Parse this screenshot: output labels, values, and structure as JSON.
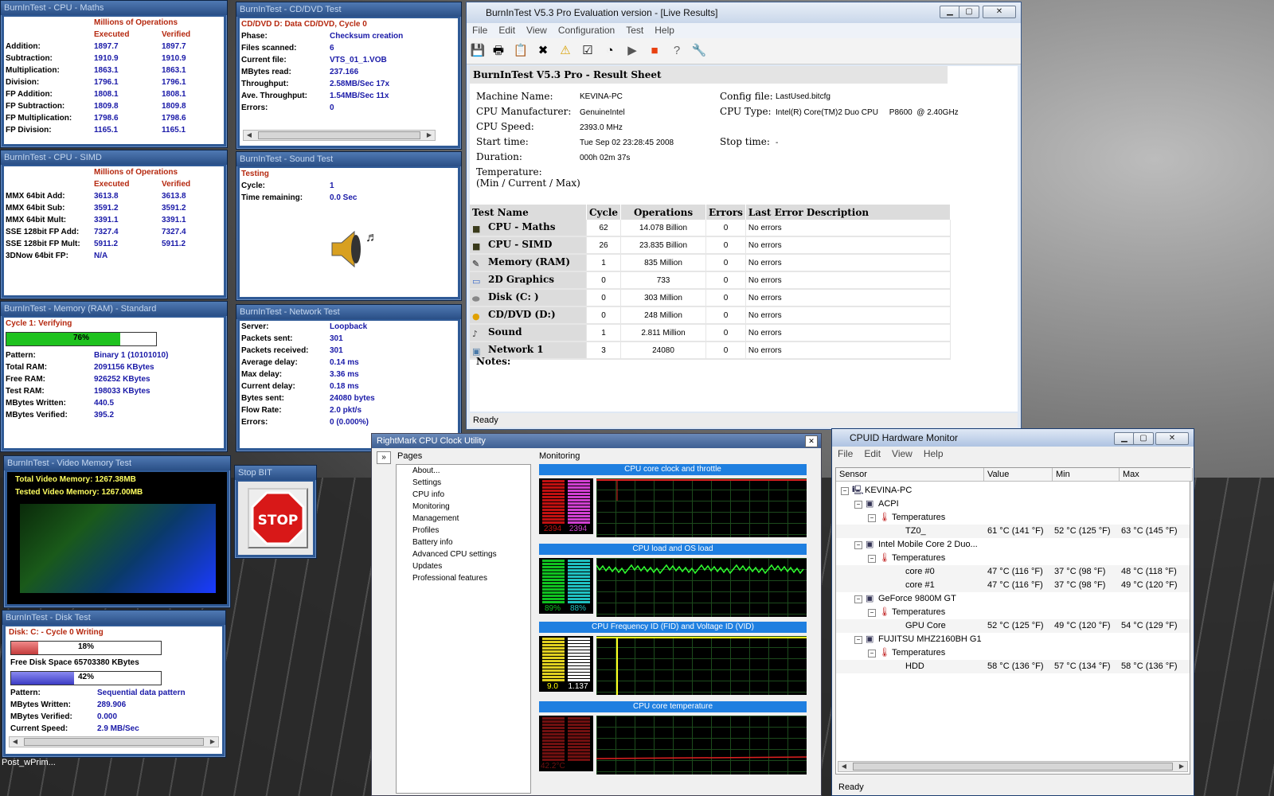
{
  "maths": {
    "title": "BurnInTest - CPU - Maths",
    "header1": "Millions of Operations",
    "col1": "Executed",
    "col2": "Verified",
    "rows": [
      [
        "Addition:",
        "1897.7",
        "1897.7"
      ],
      [
        "Subtraction:",
        "1910.9",
        "1910.9"
      ],
      [
        "Multiplication:",
        "1863.1",
        "1863.1"
      ],
      [
        "Division:",
        "1796.1",
        "1796.1"
      ],
      [
        "FP Addition:",
        "1808.1",
        "1808.1"
      ],
      [
        "FP Subtraction:",
        "1809.8",
        "1809.8"
      ],
      [
        "FP Multiplication:",
        "1798.6",
        "1798.6"
      ],
      [
        "FP Division:",
        "1165.1",
        "1165.1"
      ]
    ]
  },
  "simd": {
    "title": "BurnInTest - CPU - SIMD",
    "header1": "Millions of Operations",
    "col1": "Executed",
    "col2": "Verified",
    "rows": [
      [
        "MMX 64bit Add:",
        "3613.8",
        "3613.8"
      ],
      [
        "MMX 64bit Sub:",
        "3591.2",
        "3591.2"
      ],
      [
        "MMX 64bit Mult:",
        "3391.1",
        "3391.1"
      ],
      [
        "SSE 128bit FP Add:",
        "7327.4",
        "7327.4"
      ],
      [
        "SSE 128bit FP Mult:",
        "5911.2",
        "5911.2"
      ],
      [
        "3DNow 64bit FP:",
        "N/A",
        ""
      ]
    ]
  },
  "memory": {
    "title": "BurnInTest - Memory (RAM) - Standard",
    "status": "Cycle 1: Verifying",
    "progress": 76,
    "progress_label": "76%",
    "rows": [
      [
        "Pattern:",
        "Binary 1 (10101010)"
      ],
      [
        "Total RAM:",
        "2091156 KBytes"
      ],
      [
        "Free RAM:",
        "926252 KBytes"
      ],
      [
        "Test RAM:",
        "198033 KBytes"
      ],
      [
        "MBytes Written:",
        "440.5"
      ],
      [
        "MBytes Verified:",
        "395.2"
      ]
    ]
  },
  "video": {
    "title": "BurnInTest - Video Memory Test",
    "total": "Total Video Memory: 1267.38MB",
    "tested": "Tested Video Memory: 1267.00MB"
  },
  "disk": {
    "title": "BurnInTest - Disk Test",
    "status": "Disk: C: - Cycle 0 Writing",
    "progress1": 18,
    "progress1_label": "18%",
    "free": "Free Disk Space 65703380 KBytes",
    "progress2": 42,
    "progress2_label": "42%",
    "rows": [
      [
        "Pattern:",
        "Sequential data pattern"
      ],
      [
        "MBytes Written:",
        "289.906"
      ],
      [
        "MBytes Verified:",
        "0.000"
      ],
      [
        "Current Speed:",
        "2.9 MB/Sec"
      ]
    ]
  },
  "cd": {
    "title": "BurnInTest - CD/DVD Test",
    "status": "CD/DVD D: Data CD/DVD, Cycle 0",
    "rows": [
      [
        "Phase:",
        "Checksum creation"
      ],
      [
        "Files scanned:",
        "6"
      ],
      [
        "Current file:",
        "VTS_01_1.VOB"
      ],
      [
        "MBytes read:",
        "237.166"
      ],
      [
        "Throughput:",
        "2.58MB/Sec 17x"
      ],
      [
        "Ave. Throughput:",
        "1.54MB/Sec 11x"
      ],
      [
        "Errors:",
        "0"
      ]
    ]
  },
  "sound": {
    "title": "BurnInTest - Sound Test",
    "status": "Testing",
    "rows": [
      [
        "Cycle:",
        "1"
      ],
      [
        "Time remaining:",
        "0.0 Sec"
      ]
    ]
  },
  "network": {
    "title": "BurnInTest - Network Test",
    "rows": [
      [
        "Server:",
        "Loopback"
      ],
      [
        "Packets sent:",
        "301"
      ],
      [
        "Packets received:",
        "301"
      ],
      [
        "Average delay:",
        "0.14 ms"
      ],
      [
        "Max delay:",
        "3.36 ms"
      ],
      [
        "Current delay:",
        "0.18 ms"
      ],
      [
        "Bytes sent:",
        "24080 bytes"
      ],
      [
        "Flow Rate:",
        "2.0 pkt/s"
      ],
      [
        "Errors:",
        "0 (0.000%)"
      ]
    ]
  },
  "stop": {
    "title": "Stop BIT",
    "label": "STOP"
  },
  "main": {
    "title": "BurnInTest V5.3 Pro Evaluation version - [Live Results]",
    "menu": [
      "File",
      "Edit",
      "View",
      "Configuration",
      "Test",
      "Help"
    ],
    "sheet_title": "BurnInTest V5.3 Pro - Result Sheet",
    "machine_label": "Machine Name:",
    "machine": "KEVINA-PC",
    "manuf_label": "CPU Manufacturer:",
    "manuf": "GenuineIntel",
    "speed_label": "CPU Speed:",
    "speed": "2393.0 MHz",
    "start_label": "Start time:",
    "start": "Tue Sep 02 23:28:45 2008",
    "duration_label": "Duration:",
    "duration": "000h 02m 37s",
    "temp_label": "Temperature:",
    "temp_sub": "(Min / Current / Max)",
    "config_label": "Config file:",
    "config": "LastUsed.bitcfg",
    "cputype_label": "CPU Type:",
    "cputype": "Intel(R) Core(TM)2 Duo CPU     P8600  @ 2.40GHz",
    "stop_label": "Stop time:",
    "stop": "-",
    "columns": [
      "Test Name",
      "Cycle",
      "Operations",
      "Errors",
      "Last Error Description"
    ],
    "rows": [
      [
        "CPU - Maths",
        "62",
        "14.078 Billion",
        "0",
        "No errors"
      ],
      [
        "CPU - SIMD",
        "26",
        "23.835 Billion",
        "0",
        "No errors"
      ],
      [
        "Memory (RAM)",
        "1",
        "835 Million",
        "0",
        "No errors"
      ],
      [
        "2D Graphics",
        "0",
        "733",
        "0",
        "No errors"
      ],
      [
        "Disk (C: )",
        "0",
        "303 Million",
        "0",
        "No errors"
      ],
      [
        "CD/DVD (D:)",
        "0",
        "248 Million",
        "0",
        "No errors"
      ],
      [
        "Sound",
        "1",
        "2.811 Million",
        "0",
        "No errors"
      ],
      [
        "Network 1",
        "3",
        "24080",
        "0",
        "No errors"
      ]
    ],
    "notes": "Notes:",
    "status": "Ready"
  },
  "rightmark": {
    "title": "RightMark CPU Clock Utility",
    "pages_label": "Pages",
    "monitoring_label": "Monitoring",
    "pages": [
      "About...",
      "Settings",
      "CPU info",
      "Monitoring",
      "Management",
      "Profiles",
      "Battery info",
      "Advanced CPU settings",
      "Updates",
      "Professional features"
    ],
    "graphs": [
      {
        "title": "CPU core clock and throttle",
        "v1": "2394",
        "v2": "2394"
      },
      {
        "title": "CPU load and OS load",
        "v1": "89%",
        "v2": "88%"
      },
      {
        "title": "CPU Frequency ID (FID) and Voltage ID (VID)",
        "v1": "9.0",
        "v2": "1.137"
      },
      {
        "title": "CPU core temperature",
        "v1": "42.2°C",
        "v2": ""
      }
    ]
  },
  "hwmon": {
    "title": "CPUID Hardware Monitor",
    "menu": [
      "File",
      "Edit",
      "View",
      "Help"
    ],
    "columns": [
      "Sensor",
      "Value",
      "Min",
      "Max"
    ],
    "rows": [
      {
        "indent": 0,
        "name": "KEVINA-PC",
        "value": "",
        "min": "",
        "max": ""
      },
      {
        "indent": 1,
        "name": "ACPI",
        "value": "",
        "min": "",
        "max": ""
      },
      {
        "indent": 2,
        "name": "Temperatures",
        "value": "",
        "min": "",
        "max": ""
      },
      {
        "indent": 3,
        "name": "TZ0_",
        "value": "61 °C  (141 °F)",
        "min": "52 °C  (125 °F)",
        "max": "63 °C  (145 °F)"
      },
      {
        "indent": 1,
        "name": "Intel Mobile Core 2 Duo...",
        "value": "",
        "min": "",
        "max": ""
      },
      {
        "indent": 2,
        "name": "Temperatures",
        "value": "",
        "min": "",
        "max": ""
      },
      {
        "indent": 3,
        "name": "core #0",
        "value": "47 °C  (116 °F)",
        "min": "37 °C  (98 °F)",
        "max": "48 °C  (118 °F)"
      },
      {
        "indent": 3,
        "name": "core #1",
        "value": "47 °C  (116 °F)",
        "min": "37 °C  (98 °F)",
        "max": "49 °C  (120 °F)"
      },
      {
        "indent": 1,
        "name": "GeForce 9800M GT",
        "value": "",
        "min": "",
        "max": ""
      },
      {
        "indent": 2,
        "name": "Temperatures",
        "value": "",
        "min": "",
        "max": ""
      },
      {
        "indent": 3,
        "name": "GPU Core",
        "value": "52 °C  (125 °F)",
        "min": "49 °C  (120 °F)",
        "max": "54 °C  (129 °F)"
      },
      {
        "indent": 1,
        "name": "FUJITSU MHZ2160BH G1",
        "value": "",
        "min": "",
        "max": ""
      },
      {
        "indent": 2,
        "name": "Temperatures",
        "value": "",
        "min": "",
        "max": ""
      },
      {
        "indent": 3,
        "name": "HDD",
        "value": "58 °C  (136 °F)",
        "min": "57 °C  (134 °F)",
        "max": "58 °C  (136 °F)"
      }
    ],
    "status": "Ready"
  },
  "taskbar": {
    "label": "Post_wPrim..."
  },
  "colors": {
    "accent": "#1f7fe0",
    "value_blue": "#1a1aa8",
    "status_red": "#b5280f",
    "progress_green": "#1fc21f"
  }
}
